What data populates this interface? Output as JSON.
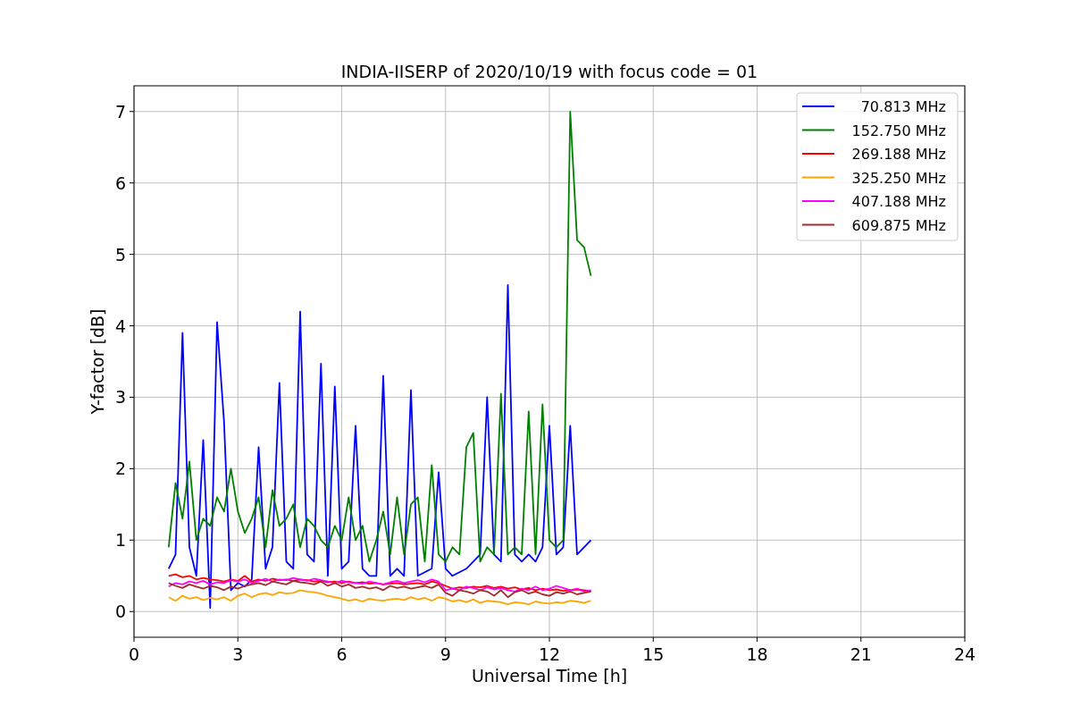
{
  "chart_data": {
    "type": "line",
    "title": "INDIA-IISERP of 2020/10/19 with focus code = 01",
    "xlabel": "Universal Time [h]",
    "ylabel": "Y-factor [dB]",
    "xlim": [
      0,
      24
    ],
    "ylim": [
      -0.36,
      7.36
    ],
    "xticks": [
      0,
      3,
      6,
      9,
      12,
      15,
      18,
      21,
      24
    ],
    "yticks": [
      0,
      1,
      2,
      3,
      4,
      5,
      6,
      7
    ],
    "grid": true,
    "legend": true,
    "x": [
      1.0,
      1.2,
      1.4,
      1.6,
      1.8,
      2.0,
      2.2,
      2.4,
      2.6,
      2.8,
      3.0,
      3.2,
      3.4,
      3.6,
      3.8,
      4.0,
      4.2,
      4.4,
      4.6,
      4.8,
      5.0,
      5.2,
      5.4,
      5.6,
      5.8,
      6.0,
      6.2,
      6.4,
      6.6,
      6.8,
      7.0,
      7.2,
      7.4,
      7.6,
      7.8,
      8.0,
      8.2,
      8.4,
      8.6,
      8.8,
      9.0,
      9.2,
      9.4,
      9.6,
      9.8,
      10.0,
      10.2,
      10.4,
      10.6,
      10.8,
      11.0,
      11.2,
      11.4,
      11.6,
      11.8,
      12.0,
      12.2,
      12.4,
      12.6,
      12.8,
      13.0,
      13.2
    ],
    "series": [
      {
        "name": "70.813 MHz",
        "color": "#0000ff",
        "values": [
          0.6,
          0.8,
          3.9,
          0.9,
          0.5,
          2.4,
          0.05,
          4.05,
          2.65,
          0.3,
          0.4,
          0.35,
          0.45,
          2.3,
          0.6,
          0.9,
          3.2,
          0.7,
          0.6,
          4.2,
          0.8,
          0.7,
          3.47,
          0.5,
          3.15,
          0.6,
          0.7,
          2.6,
          0.6,
          0.5,
          0.5,
          3.3,
          0.5,
          0.6,
          0.5,
          3.1,
          0.5,
          0.55,
          0.6,
          1.95,
          0.6,
          0.5,
          0.55,
          0.6,
          0.7,
          0.8,
          3.0,
          0.8,
          0.7,
          4.57,
          0.8,
          0.7,
          0.8,
          0.7,
          0.9,
          2.6,
          0.8,
          0.9,
          2.6,
          0.8,
          0.9,
          1.0
        ]
      },
      {
        "name": "152.750 MHz",
        "color": "#008000",
        "values": [
          0.9,
          1.8,
          1.3,
          2.1,
          1.0,
          1.3,
          1.2,
          1.6,
          1.4,
          2.0,
          1.4,
          1.1,
          1.3,
          1.6,
          0.9,
          1.7,
          1.2,
          1.3,
          1.5,
          0.9,
          1.3,
          1.2,
          1.0,
          0.9,
          1.2,
          1.0,
          1.6,
          1.0,
          1.2,
          0.7,
          1.0,
          1.4,
          0.8,
          1.6,
          0.8,
          1.5,
          1.6,
          0.7,
          2.05,
          0.8,
          0.7,
          0.9,
          0.8,
          2.3,
          2.5,
          0.7,
          0.9,
          0.8,
          3.05,
          0.8,
          0.9,
          0.8,
          2.8,
          0.8,
          2.9,
          1.0,
          0.9,
          1.0,
          7.0,
          5.2,
          5.1,
          4.7
        ]
      },
      {
        "name": "269.188 MHz",
        "color": "#ff0000",
        "values": [
          0.5,
          0.52,
          0.48,
          0.5,
          0.45,
          0.47,
          0.45,
          0.44,
          0.42,
          0.45,
          0.43,
          0.5,
          0.42,
          0.45,
          0.43,
          0.46,
          0.44,
          0.45,
          0.43,
          0.45,
          0.44,
          0.42,
          0.43,
          0.41,
          0.42,
          0.4,
          0.42,
          0.4,
          0.41,
          0.39,
          0.4,
          0.38,
          0.39,
          0.4,
          0.38,
          0.39,
          0.4,
          0.38,
          0.42,
          0.4,
          0.36,
          0.32,
          0.34,
          0.33,
          0.35,
          0.34,
          0.36,
          0.33,
          0.35,
          0.32,
          0.34,
          0.31,
          0.33,
          0.3,
          0.32,
          0.3,
          0.31,
          0.29,
          0.3,
          0.31,
          0.3,
          0.29
        ]
      },
      {
        "name": "325.250 MHz",
        "color": "#ffa500",
        "values": [
          0.2,
          0.15,
          0.22,
          0.18,
          0.2,
          0.16,
          0.19,
          0.17,
          0.2,
          0.15,
          0.22,
          0.25,
          0.2,
          0.24,
          0.26,
          0.23,
          0.27,
          0.25,
          0.26,
          0.3,
          0.28,
          0.27,
          0.25,
          0.22,
          0.2,
          0.18,
          0.15,
          0.17,
          0.14,
          0.18,
          0.16,
          0.15,
          0.17,
          0.18,
          0.16,
          0.2,
          0.17,
          0.19,
          0.15,
          0.2,
          0.18,
          0.14,
          0.16,
          0.13,
          0.17,
          0.12,
          0.15,
          0.14,
          0.13,
          0.1,
          0.13,
          0.12,
          0.1,
          0.14,
          0.12,
          0.11,
          0.13,
          0.12,
          0.15,
          0.14,
          0.12,
          0.15
        ]
      },
      {
        "name": "407.188 MHz",
        "color": "#ff00ff",
        "values": [
          0.35,
          0.4,
          0.38,
          0.42,
          0.4,
          0.43,
          0.38,
          0.41,
          0.4,
          0.44,
          0.42,
          0.45,
          0.4,
          0.43,
          0.46,
          0.42,
          0.45,
          0.44,
          0.47,
          0.45,
          0.43,
          0.46,
          0.44,
          0.42,
          0.4,
          0.43,
          0.41,
          0.4,
          0.39,
          0.42,
          0.4,
          0.38,
          0.41,
          0.43,
          0.4,
          0.42,
          0.44,
          0.41,
          0.45,
          0.42,
          0.3,
          0.32,
          0.3,
          0.35,
          0.33,
          0.3,
          0.34,
          0.31,
          0.33,
          0.3,
          0.28,
          0.32,
          0.3,
          0.35,
          0.3,
          0.32,
          0.36,
          0.33,
          0.3,
          0.32,
          0.28,
          0.3
        ]
      },
      {
        "name": "609.875 MHz",
        "color": "#a52a2a",
        "values": [
          0.4,
          0.36,
          0.33,
          0.38,
          0.35,
          0.32,
          0.36,
          0.34,
          0.3,
          0.35,
          0.32,
          0.36,
          0.38,
          0.4,
          0.37,
          0.42,
          0.4,
          0.38,
          0.43,
          0.41,
          0.4,
          0.38,
          0.42,
          0.36,
          0.4,
          0.35,
          0.38,
          0.33,
          0.35,
          0.32,
          0.34,
          0.3,
          0.36,
          0.33,
          0.35,
          0.32,
          0.34,
          0.36,
          0.33,
          0.38,
          0.26,
          0.22,
          0.3,
          0.28,
          0.25,
          0.3,
          0.28,
          0.22,
          0.3,
          0.2,
          0.27,
          0.3,
          0.25,
          0.28,
          0.24,
          0.22,
          0.27,
          0.25,
          0.28,
          0.24,
          0.26,
          0.28
        ]
      }
    ]
  }
}
